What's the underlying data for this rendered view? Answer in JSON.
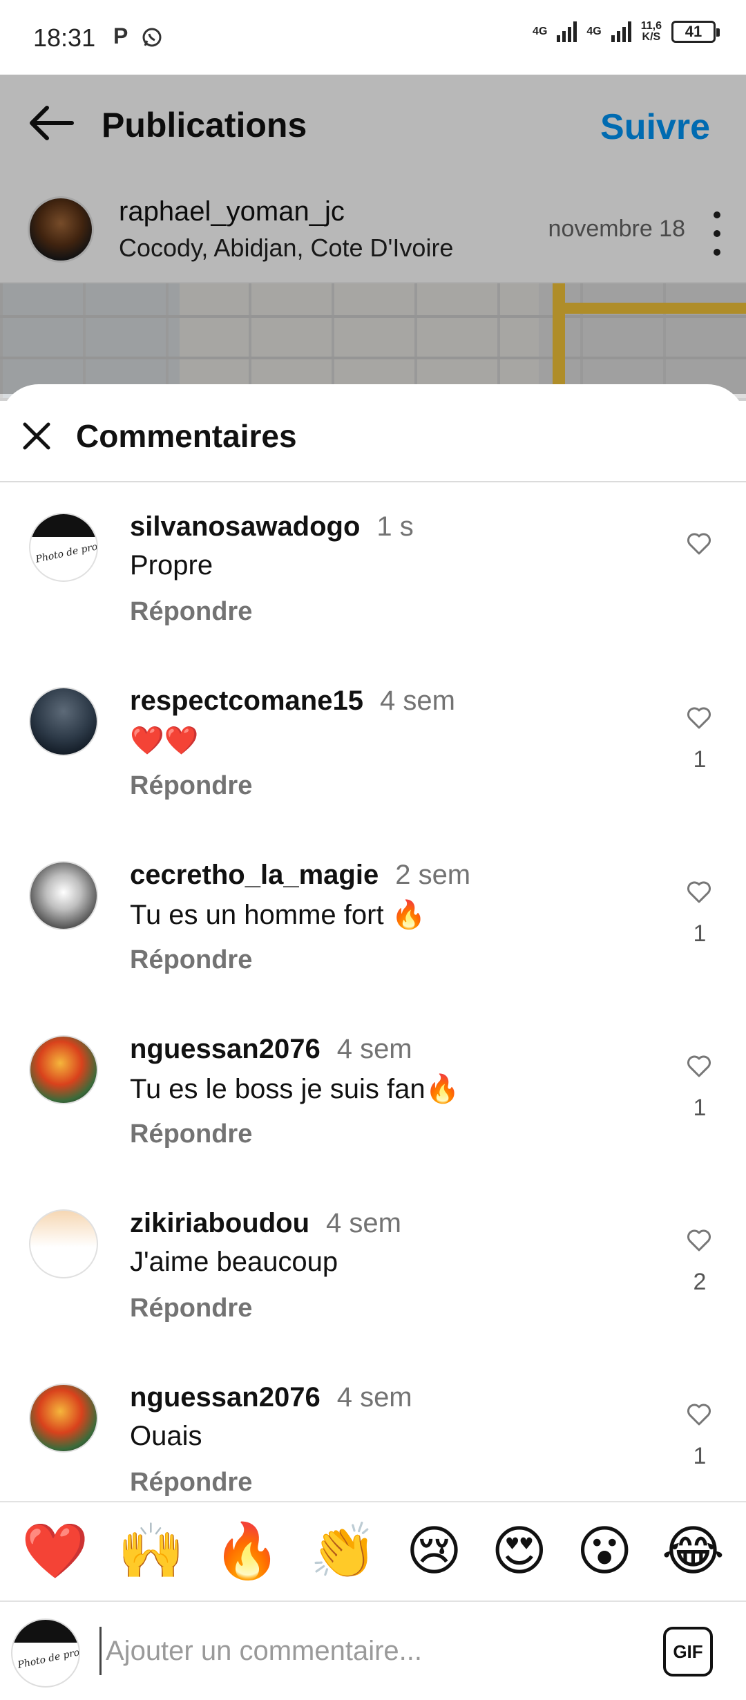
{
  "status_bar": {
    "time": "18:31",
    "app_icons": [
      "P",
      "whatsapp-icon"
    ],
    "network_1": "4G",
    "network_2": "4G",
    "speed_value": "11,6",
    "speed_unit": "K/S",
    "battery": "41"
  },
  "background_page": {
    "title": "Publications",
    "follow_label": "Suivre",
    "author": {
      "username": "raphael_yoman_jc",
      "location": "Cocody, Abidjan, Cote D'Ivoire",
      "date": "novembre 18"
    }
  },
  "comments_sheet": {
    "title": "Commentaires",
    "comments": [
      {
        "username": "silvanosawadogo",
        "time": "1 s",
        "text": "Propre",
        "reply_label": "Répondre",
        "likes": ""
      },
      {
        "username": "respectcomane15",
        "time": "4 sem",
        "text": "❤️❤️",
        "reply_label": "Répondre",
        "likes": "1"
      },
      {
        "username": "cecretho_la_magie",
        "time": "2 sem",
        "text": "Tu es un homme fort 🔥",
        "reply_label": "Répondre",
        "likes": "1"
      },
      {
        "username": "nguessan2076",
        "time": "4 sem",
        "text": "Tu es le boss je suis fan🔥",
        "reply_label": "Répondre",
        "likes": "1"
      },
      {
        "username": "zikiriaboudou",
        "time": "4 sem",
        "text": "J'aime beaucoup",
        "reply_label": "Répondre",
        "likes": "2"
      },
      {
        "username": "nguessan2076",
        "time": "4 sem",
        "text": "Ouais",
        "reply_label": "Répondre",
        "likes": "1"
      }
    ],
    "avatar_caption": "Photo de profil en congé"
  },
  "emoji_bar": [
    "❤️",
    "🙌",
    "🔥",
    "👏",
    "😢",
    "😍",
    "😮",
    "😂"
  ],
  "comment_input": {
    "placeholder": "Ajouter un commentaire...",
    "gif_label": "GIF"
  },
  "colors": {
    "accent": "#0095f6",
    "secondary_text": "#737373"
  }
}
